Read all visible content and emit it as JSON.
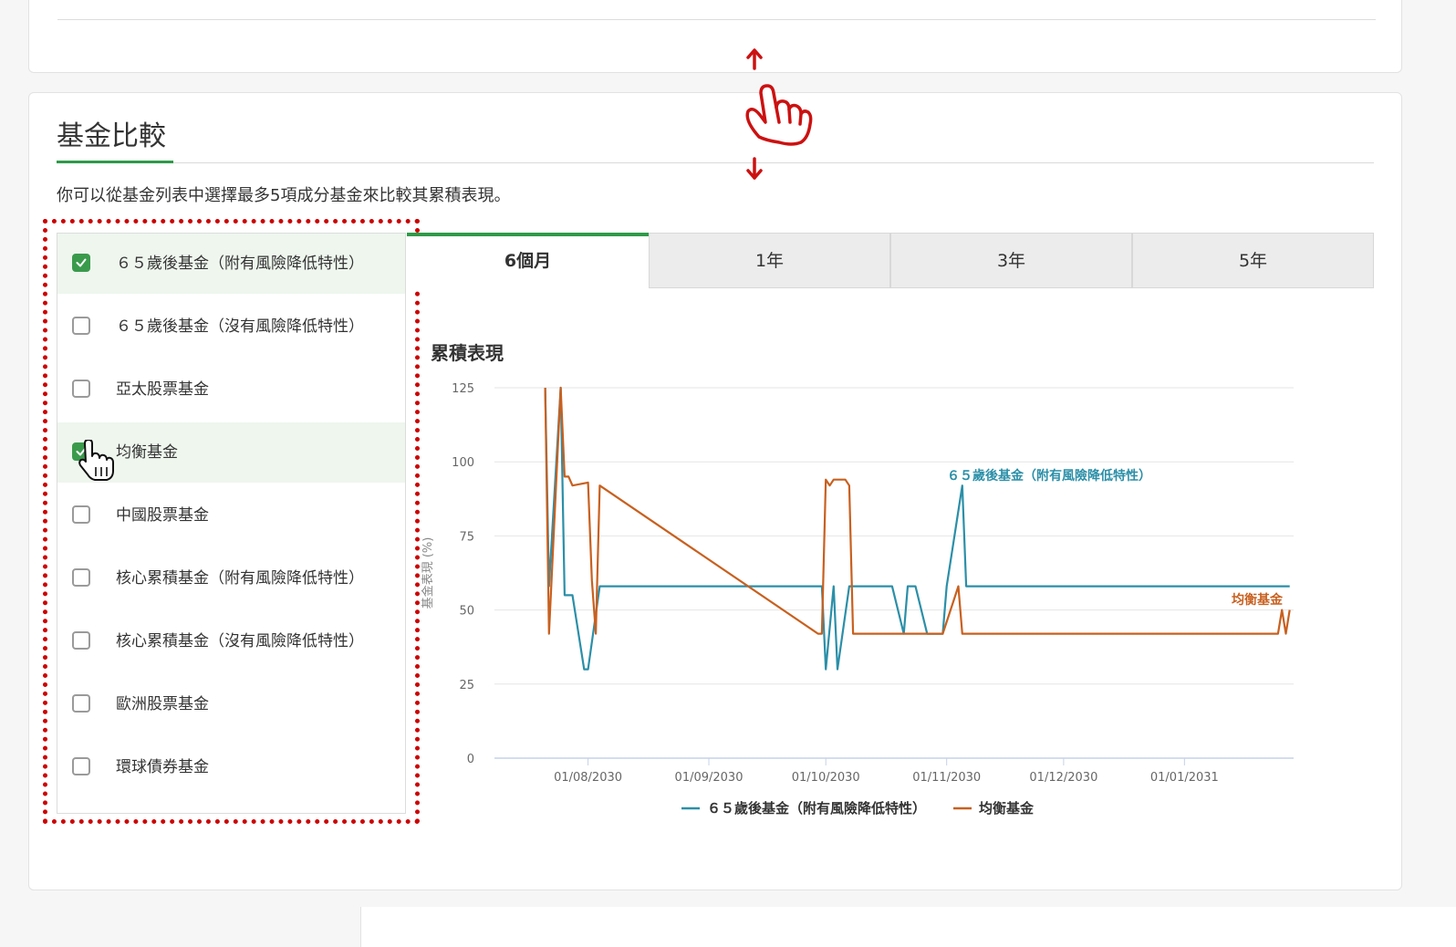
{
  "section": {
    "title": "基金比較",
    "description": "你可以從基金列表中選擇最多5項成分基金來比較其累積表現。"
  },
  "fund_list": [
    {
      "label": "６５歲後基金（附有風險降低特性）",
      "checked": true
    },
    {
      "label": "６５歲後基金（沒有風險降低特性）",
      "checked": false
    },
    {
      "label": "亞太股票基金",
      "checked": false
    },
    {
      "label": "均衡基金",
      "checked": true
    },
    {
      "label": "中國股票基金",
      "checked": false
    },
    {
      "label": "核心累積基金（附有風險降低特性）",
      "checked": false
    },
    {
      "label": "核心累積基金（沒有風險降低特性）",
      "checked": false
    },
    {
      "label": "歐洲股票基金",
      "checked": false
    },
    {
      "label": "環球債券基金",
      "checked": false
    }
  ],
  "tabs": [
    {
      "label": "6個月",
      "active": true
    },
    {
      "label": "1年",
      "active": false
    },
    {
      "label": "3年",
      "active": false
    },
    {
      "label": "5年",
      "active": false
    }
  ],
  "chart": {
    "title": "累積表現"
  },
  "colors": {
    "accent": "#2e9a48",
    "series1": "#2b8fa8",
    "series2": "#c8601f",
    "highlight": "#cc0000"
  },
  "chart_data": {
    "type": "line",
    "title": "累積表現",
    "ylabel": "基金表現 (%)",
    "xlabel": "",
    "ylim": [
      0,
      125
    ],
    "yticks": [
      0,
      25,
      50,
      75,
      100,
      125
    ],
    "xlim": [
      "2030-07-08",
      "2031-01-29"
    ],
    "xticks": [
      {
        "date": "2030-08-01",
        "label": "01/08/2030"
      },
      {
        "date": "2030-09-01",
        "label": "01/09/2030"
      },
      {
        "date": "2030-10-01",
        "label": "01/10/2030"
      },
      {
        "date": "2030-11-01",
        "label": "01/11/2030"
      },
      {
        "date": "2030-12-01",
        "label": "01/12/2030"
      },
      {
        "date": "2031-01-01",
        "label": "01/01/2031"
      }
    ],
    "grid": true,
    "legend": "bottom",
    "series": [
      {
        "name": "６５歲後基金（附有風險降低特性）",
        "color": "#2b8fa8",
        "end_label": true,
        "points": [
          [
            "2030-07-21",
            125
          ],
          [
            "2030-07-22",
            58
          ],
          [
            "2030-07-25",
            125
          ],
          [
            "2030-07-26",
            55
          ],
          [
            "2030-07-28",
            55
          ],
          [
            "2030-07-31",
            30
          ],
          [
            "2030-08-01",
            30
          ],
          [
            "2030-08-04",
            58
          ],
          [
            "2030-09-30",
            58
          ],
          [
            "2030-10-01",
            30
          ],
          [
            "2030-10-03",
            58
          ],
          [
            "2030-10-04",
            30
          ],
          [
            "2030-10-07",
            58
          ],
          [
            "2030-10-18",
            58
          ],
          [
            "2030-10-21",
            42
          ],
          [
            "2030-10-22",
            58
          ],
          [
            "2030-10-24",
            58
          ],
          [
            "2030-10-27",
            42
          ],
          [
            "2030-10-31",
            42
          ],
          [
            "2030-11-01",
            58
          ],
          [
            "2030-11-05",
            92
          ],
          [
            "2030-11-06",
            58
          ],
          [
            "2031-01-28",
            58
          ]
        ]
      },
      {
        "name": "均衡基金",
        "color": "#c8601f",
        "end_label": true,
        "points": [
          [
            "2030-07-21",
            125
          ],
          [
            "2030-07-22",
            42
          ],
          [
            "2030-07-25",
            125
          ],
          [
            "2030-07-26",
            95
          ],
          [
            "2030-07-27",
            95
          ],
          [
            "2030-07-28",
            92
          ],
          [
            "2030-08-01",
            93
          ],
          [
            "2030-08-02",
            60
          ],
          [
            "2030-08-03",
            42
          ],
          [
            "2030-08-04",
            92
          ],
          [
            "2030-09-29",
            42
          ],
          [
            "2030-09-30",
            42
          ],
          [
            "2030-10-01",
            94
          ],
          [
            "2030-10-02",
            92
          ],
          [
            "2030-10-03",
            94
          ],
          [
            "2030-10-06",
            94
          ],
          [
            "2030-10-07",
            92
          ],
          [
            "2030-10-08",
            42
          ],
          [
            "2030-10-31",
            42
          ],
          [
            "2030-11-04",
            58
          ],
          [
            "2030-11-05",
            42
          ],
          [
            "2031-01-25",
            42
          ],
          [
            "2031-01-26",
            50
          ],
          [
            "2031-01-27",
            42
          ],
          [
            "2031-01-28",
            50
          ]
        ]
      }
    ]
  }
}
